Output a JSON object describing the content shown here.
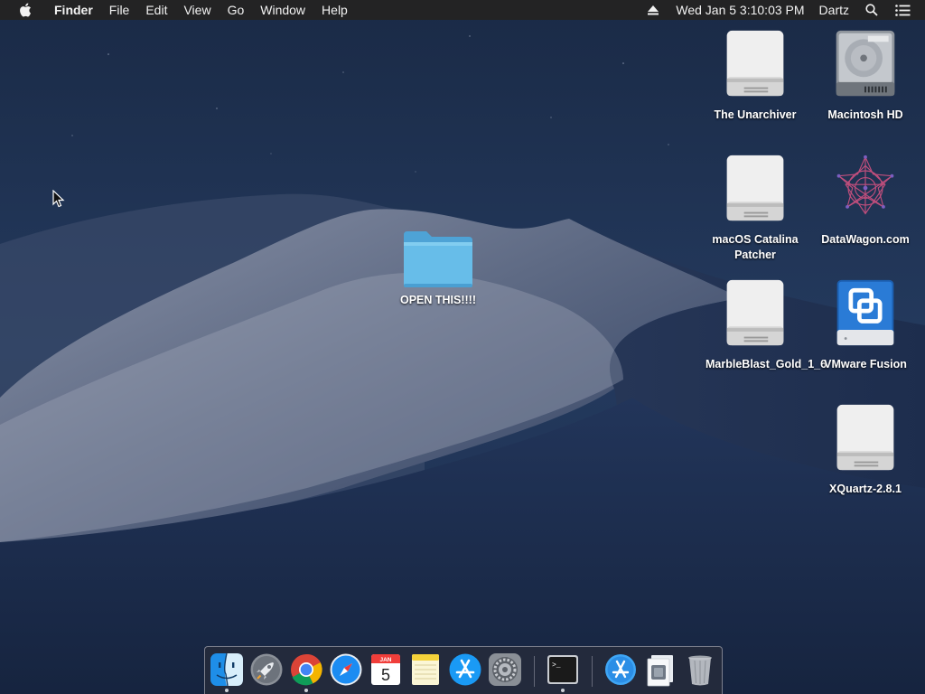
{
  "menubar": {
    "apple_icon": "apple-logo-icon",
    "app_name": "Finder",
    "menus": [
      "File",
      "Edit",
      "View",
      "Go",
      "Window",
      "Help"
    ],
    "clock": "Wed Jan 5  3:10:03 PM",
    "user": "Dartz",
    "icons": [
      "eject-icon",
      "spotlight-search-icon",
      "notification-center-icon"
    ]
  },
  "desktop": {
    "folder": {
      "label": "OPEN THIS!!!!",
      "icon": "blue-folder-icon"
    },
    "items": [
      {
        "label": "The Unarchiver",
        "icon": "external-drive-icon"
      },
      {
        "label": "Macintosh HD",
        "icon": "internal-hard-drive-icon"
      },
      {
        "label": "macOS Catalina Patcher",
        "icon": "external-drive-icon"
      },
      {
        "label": "DataWagon.com",
        "icon": "network-star-logo-icon"
      },
      {
        "label": "MarbleBlast_Gold_1_6",
        "icon": "external-drive-icon"
      },
      {
        "label": "VMware Fusion",
        "icon": "vmware-fusion-icon"
      },
      {
        "label": "XQuartz-2.8.1",
        "icon": "external-drive-icon"
      }
    ]
  },
  "dock": {
    "apps": [
      {
        "name": "Finder",
        "icon": "finder-icon",
        "running": true
      },
      {
        "name": "Launchpad",
        "icon": "launchpad-rocket-icon",
        "running": false
      },
      {
        "name": "Google Chrome",
        "icon": "chrome-icon",
        "running": true
      },
      {
        "name": "Safari",
        "icon": "safari-compass-icon",
        "running": false
      },
      {
        "name": "Calendar",
        "icon": "calendar-icon",
        "running": false,
        "month": "JAN",
        "day": "5"
      },
      {
        "name": "Notes",
        "icon": "notes-icon",
        "running": false
      },
      {
        "name": "App Store",
        "icon": "app-store-icon",
        "running": false
      },
      {
        "name": "System Preferences",
        "icon": "gear-icon",
        "running": false
      },
      {
        "name": "Terminal",
        "icon": "terminal-icon",
        "running": true
      },
      {
        "name": "Applications",
        "icon": "applications-folder-icon",
        "running": false
      },
      {
        "name": "Downloads",
        "icon": "downloads-stack-icon",
        "running": false
      },
      {
        "name": "Trash",
        "icon": "trash-icon",
        "running": false
      }
    ],
    "terminal_prompt": ">_"
  },
  "colors": {
    "menubar_bg": "#232324",
    "wallpaper_sky": "#1f3253",
    "folder_blue": "#5fb4e3"
  }
}
